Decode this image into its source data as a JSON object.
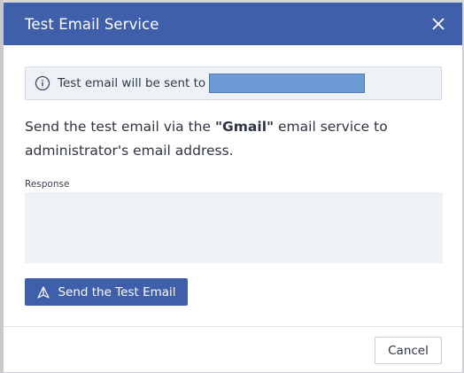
{
  "dialog": {
    "title": "Test Email Service",
    "close_icon": "close-icon"
  },
  "info": {
    "icon": "info-icon",
    "text": "Test email will be sent to"
  },
  "description": {
    "prefix": "Send the test email via the ",
    "service_name": "\"Gmail\"",
    "suffix": " email service to administrator's email address."
  },
  "response": {
    "label": "Response",
    "value": ""
  },
  "buttons": {
    "send_label": "Send the Test Email",
    "send_icon": "send-icon",
    "cancel_label": "Cancel"
  },
  "colors": {
    "header_bg": "#3f5faa",
    "primary_button": "#3f5faa",
    "info_bg": "#eef2f7",
    "response_bg": "#eef1f6"
  }
}
